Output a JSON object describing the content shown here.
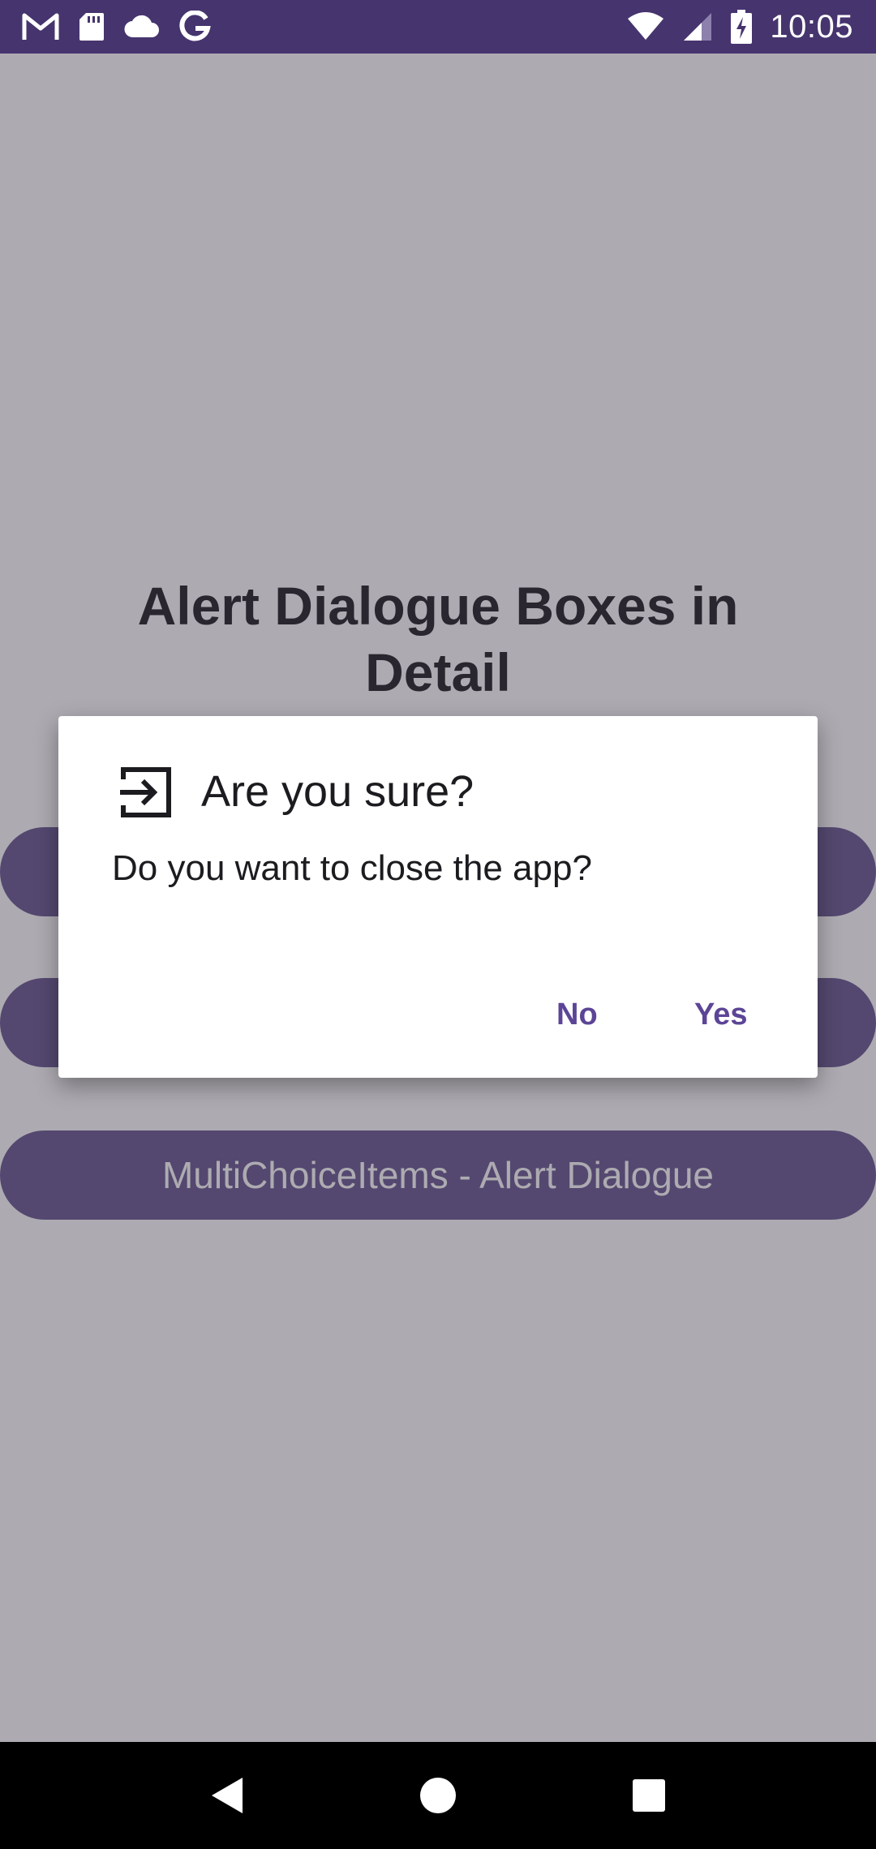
{
  "status_bar": {
    "time": "10:05",
    "left_icons": [
      "gmail-icon",
      "sd-card-icon",
      "cloud-icon",
      "google-icon"
    ],
    "right_icons": [
      "wifi-icon",
      "cellular-signal-icon",
      "battery-charging-icon"
    ]
  },
  "main": {
    "title": "Alert Dialogue Boxes in Detail",
    "buttons": [
      {
        "label": ""
      },
      {
        "label": ""
      },
      {
        "label": "MultiChoiceItems - Alert Dialogue"
      }
    ]
  },
  "dialog": {
    "icon": "exit-to-app-icon",
    "title": "Are you sure?",
    "message": "Do you want to close the app?",
    "negative_label": "No",
    "positive_label": "Yes"
  },
  "nav_bar": {
    "icons": [
      "back-icon",
      "home-icon",
      "recents-icon"
    ]
  },
  "colors": {
    "primary": "#46346e",
    "button": "#66558f",
    "accent": "#5c4596",
    "scrim": "rgba(60,55,70,0.42)"
  }
}
